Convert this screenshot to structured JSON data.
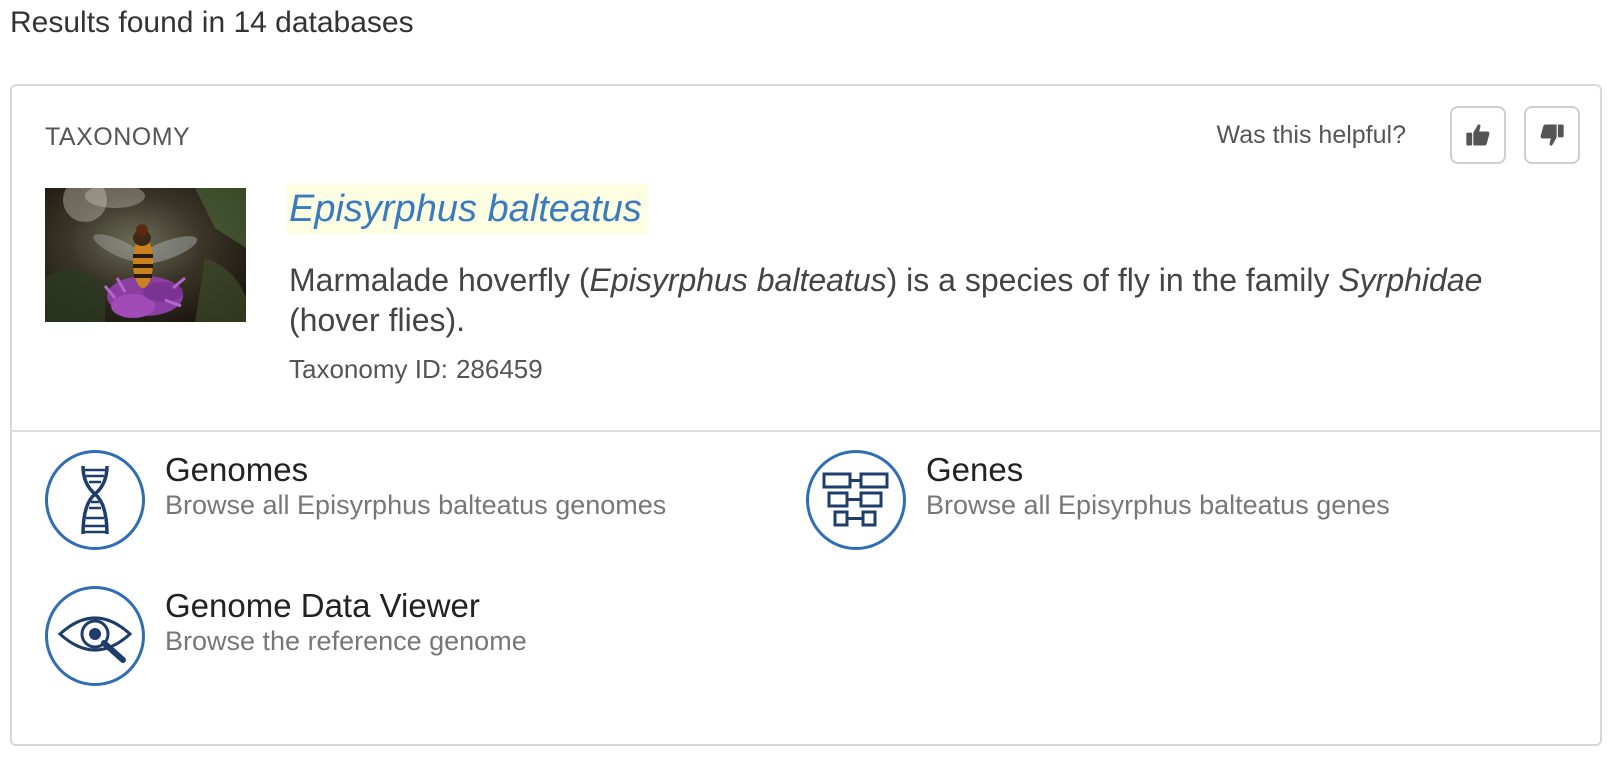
{
  "results_heading": "Results found in 14 databases",
  "card": {
    "section_label": "TAXONOMY",
    "feedback": {
      "question": "Was this helpful?",
      "thumbs_up_icon": "thumbs-up-icon",
      "thumbs_down_icon": "thumbs-down-icon"
    },
    "species_title": "Episyrphus balteatus",
    "description": {
      "part1": "Marmalade hoverfly (",
      "italic1": "Episyrphus balteatus",
      "part2": ") is a species of fly in the family ",
      "italic2": "Syrphidae",
      "part3": " (hover flies)."
    },
    "taxonomy_id": {
      "label": "Taxonomy ID:",
      "value": "286459"
    },
    "links": [
      {
        "icon": "dna-helix-icon",
        "title": "Genomes",
        "description": "Browse all Episyrphus balteatus genomes"
      },
      {
        "icon": "gene-blocks-icon",
        "title": "Genes",
        "description": "Browse all Episyrphus balteatus genes"
      },
      {
        "icon": "eye-magnifier-icon",
        "title": "Genome Data Viewer",
        "description": "Browse the reference genome"
      }
    ]
  },
  "colors": {
    "accent_blue": "#3a7bbf",
    "icon_circle": "#2f6db5",
    "title_highlight": "#fdfde2"
  }
}
